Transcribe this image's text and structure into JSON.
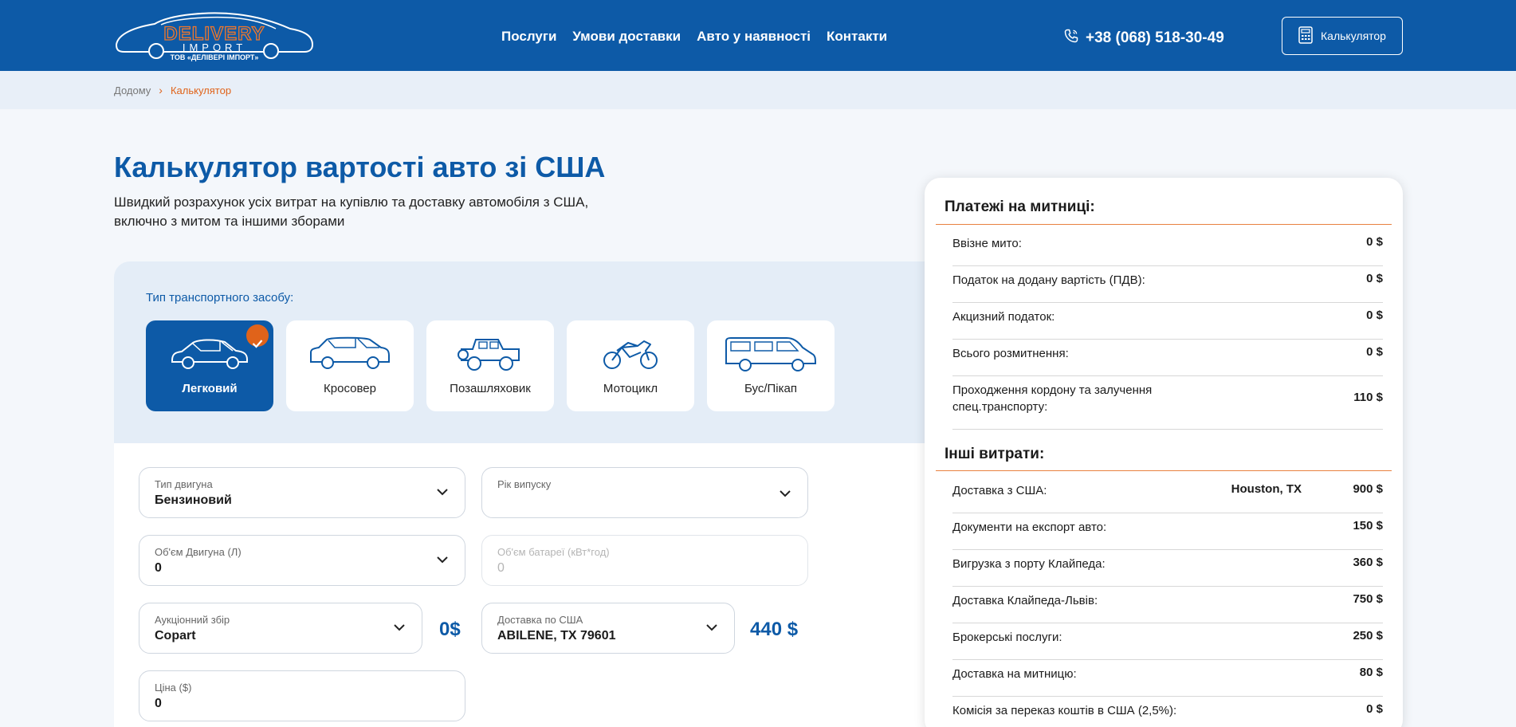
{
  "header": {
    "logo_text": "DELIVERY",
    "logo_sub": "IMPORT",
    "logo_company": "ТОВ «ДЕЛІВЕРІ ІМПОРТ»",
    "nav": [
      "Послуги",
      "Умови доставки",
      "Авто у наявності",
      "Контакти"
    ],
    "phone": "+38 (068) 518-30-49",
    "calc_button": "Калькулятор"
  },
  "breadcrumb": {
    "home": "Додому",
    "separator": "›",
    "current": "Калькулятор"
  },
  "page": {
    "title": "Калькулятор вартості авто зі США",
    "subtitle_line1": "Швидкий розрахунок усіх витрат на купівлю та доставку автомобіля з США,",
    "subtitle_line2": "включно з митом та іншими зборами"
  },
  "vehicle_types": {
    "label": "Тип транспортного засобу:",
    "items": [
      "Легковий",
      "Кросовер",
      "Позашляховик",
      "Мотоцикл",
      "Бус/Пікап"
    ],
    "selected": "Легковий"
  },
  "form": {
    "engine_type": {
      "label": "Тип двигуна",
      "value": "Бензиновий"
    },
    "year": {
      "label": "Рік випуску",
      "value": ""
    },
    "engine_volume": {
      "label": "Об'єм Двигуна (Л)",
      "value": "0"
    },
    "battery": {
      "label": "Об'єм батареї (кВт*год)",
      "value": "0"
    },
    "auction": {
      "label": "Аукціонний збір",
      "value": "Copart",
      "fee": "0$"
    },
    "us_delivery": {
      "label": "Доставка по США",
      "value": "ABILENE, TX 79601",
      "fee": "440 $"
    },
    "price": {
      "label": "Ціна ($)",
      "value": "0"
    }
  },
  "summary": {
    "customs_title": "Платежі на митниці:",
    "customs": [
      {
        "label": "Ввізне мито:",
        "value": "0 $"
      },
      {
        "label": "Податок на додану вартість (ПДВ):",
        "value": "0 $"
      },
      {
        "label": "Акцизний податок:",
        "value": "0 $"
      },
      {
        "label": "Всього розмитнення:",
        "value": "0 $"
      },
      {
        "label": "Проходження кордону та залучення",
        "label2": "спец.транспорту:",
        "value": "110 $"
      }
    ],
    "other_title": "Інші витрати:",
    "other": [
      {
        "label": "Доставка з США:",
        "city": "Houston, TX",
        "value": "900 $"
      },
      {
        "label": "Документи на експорт авто:",
        "value": "150 $"
      },
      {
        "label": "Вигрузка з порту Клайпеда:",
        "value": "360 $"
      },
      {
        "label": "Доставка Клайпеда-Львів:",
        "value": "750 $"
      },
      {
        "label": "Брокерські послуги:",
        "value": "250 $"
      },
      {
        "label": "Доставка на митницю:",
        "value": "80 $"
      },
      {
        "label": "Комісія за переказ коштів в США (2,5%):",
        "value": "0 $"
      }
    ]
  },
  "colors": {
    "brand_blue": "#0d5aa7",
    "accent_orange": "#e0631a"
  }
}
